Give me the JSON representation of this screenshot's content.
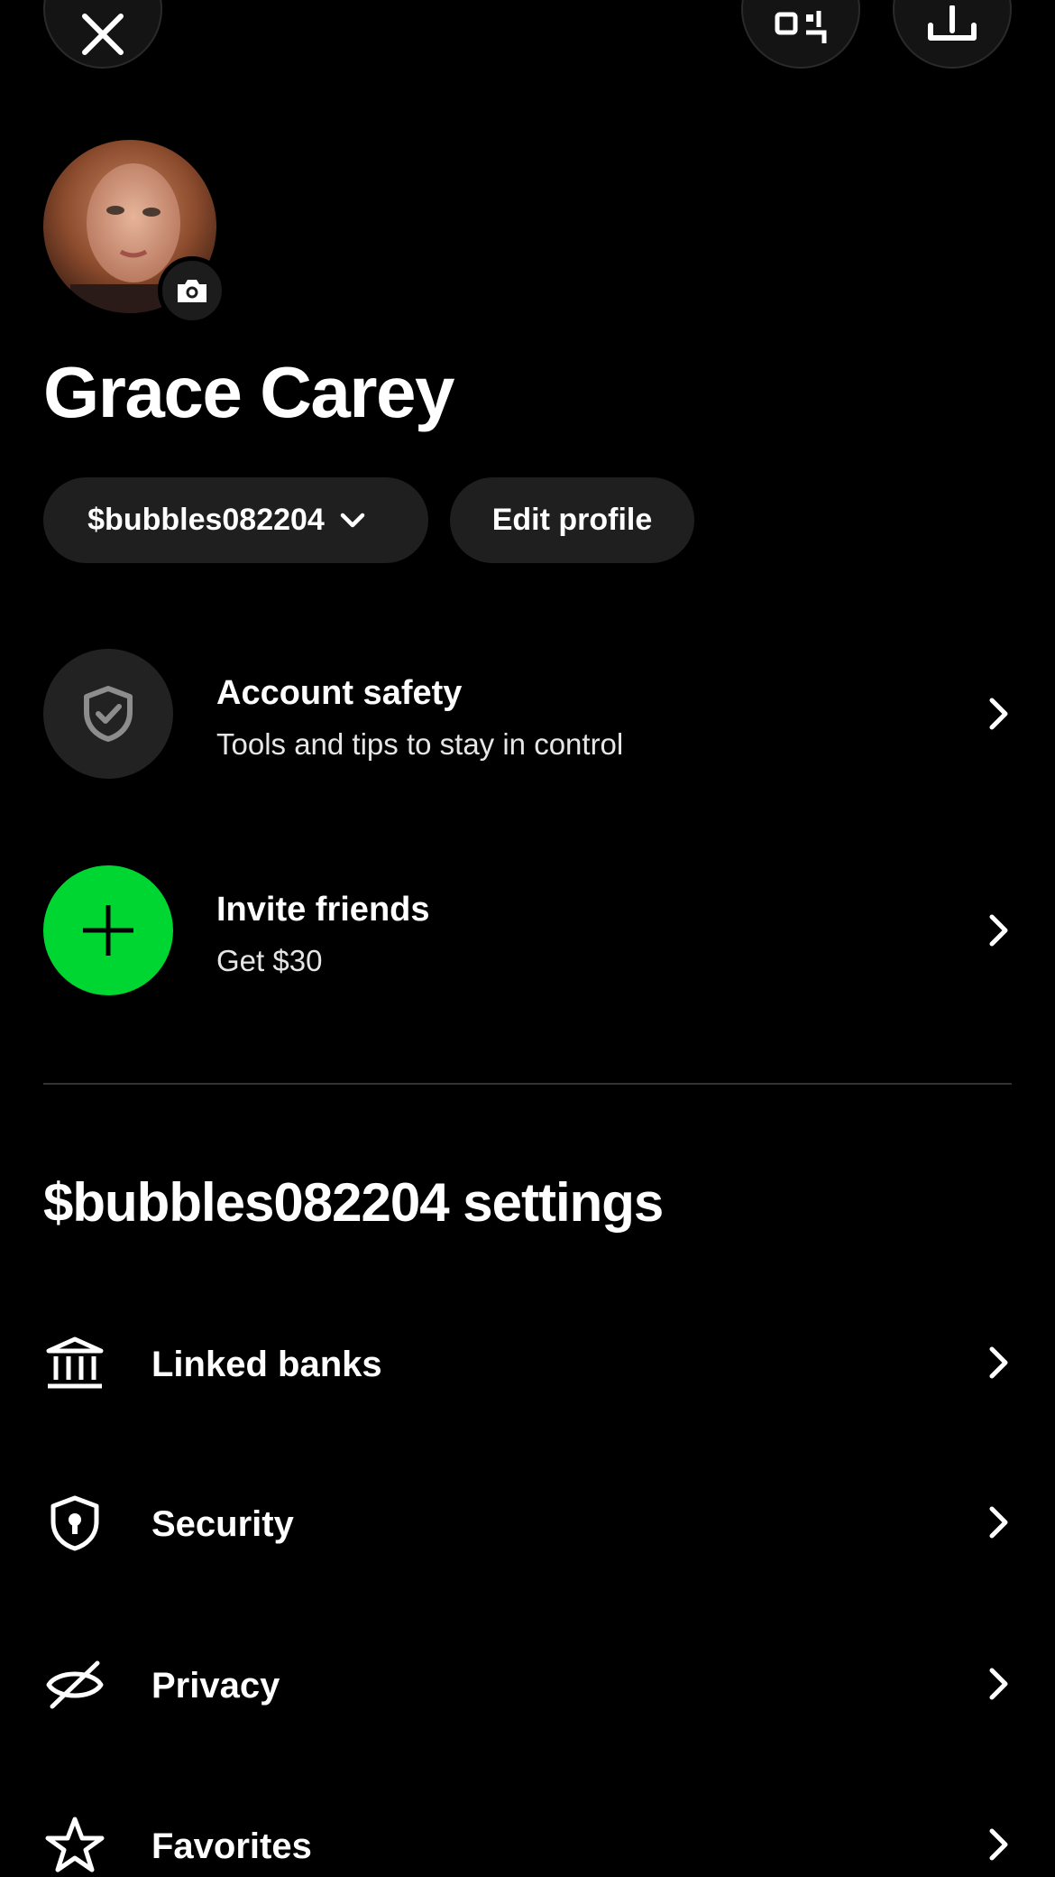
{
  "top_bar": {
    "close_icon": "close-icon",
    "qr_icon": "qr-scan-icon",
    "share_icon": "share-upload-icon"
  },
  "profile": {
    "name": "Grace Carey",
    "cashtag": "$bubbles082204",
    "edit_label": "Edit profile",
    "avatar_icon": "avatar-photo",
    "camera_icon": "camera-icon"
  },
  "features": [
    {
      "title": "Account safety",
      "subtitle": "Tools and tips to stay in control",
      "icon": "shield-check-icon"
    },
    {
      "title": "Invite friends",
      "subtitle": "Get $30",
      "icon": "plus-icon"
    }
  ],
  "settings": {
    "heading": "$bubbles082204 settings",
    "items": [
      {
        "label": "Linked banks",
        "icon": "bank-icon"
      },
      {
        "label": "Security",
        "icon": "shield-lock-icon"
      },
      {
        "label": "Privacy",
        "icon": "eye-off-icon"
      },
      {
        "label": "Favorites",
        "icon": "star-icon"
      }
    ]
  },
  "colors": {
    "background": "#000000",
    "pill_background": "#1f1f1f",
    "accent_green": "#00d632",
    "divider": "#333333"
  }
}
